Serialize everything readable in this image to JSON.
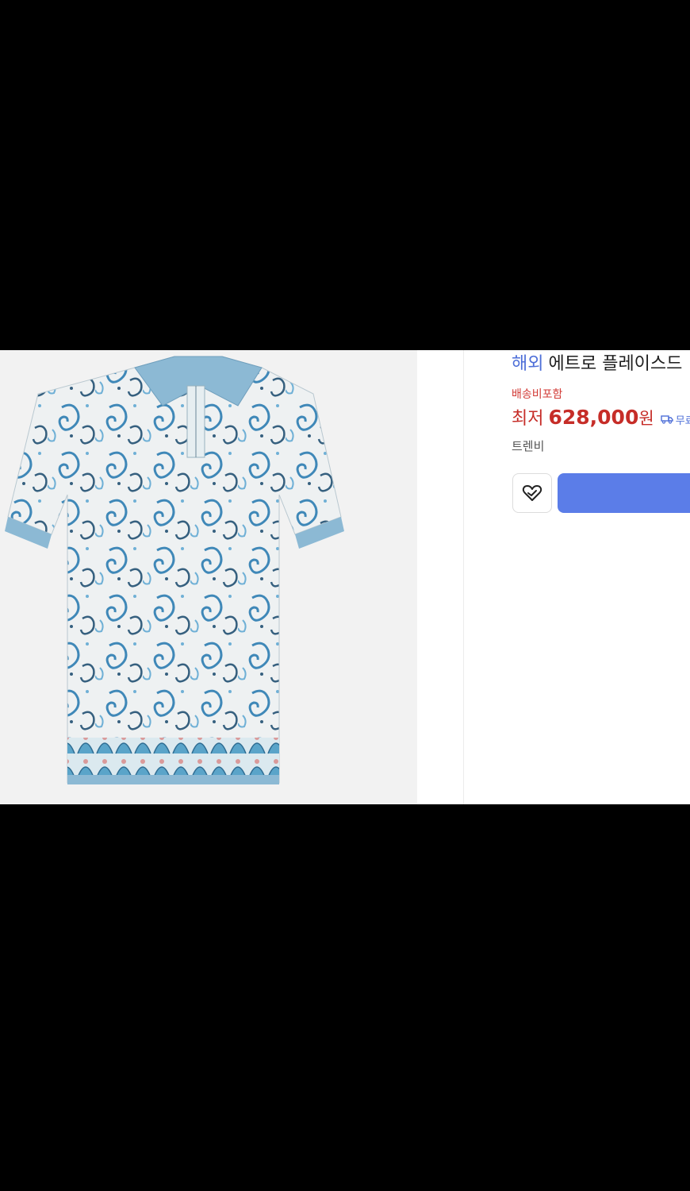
{
  "product": {
    "badge": "해외",
    "title": "에트로 플레이스드",
    "shipping_note": "배송비포함",
    "price_label": "최저",
    "price_value": "628,000",
    "price_unit": "원",
    "free_shipping": "무료",
    "seller": "트렌비"
  },
  "icons": {
    "wishlist": "heart-check-icon",
    "delivery": "truck-icon"
  },
  "colors": {
    "accent": "#5b7de8",
    "price": "#c62d28",
    "badge": "#4e6fd8"
  }
}
